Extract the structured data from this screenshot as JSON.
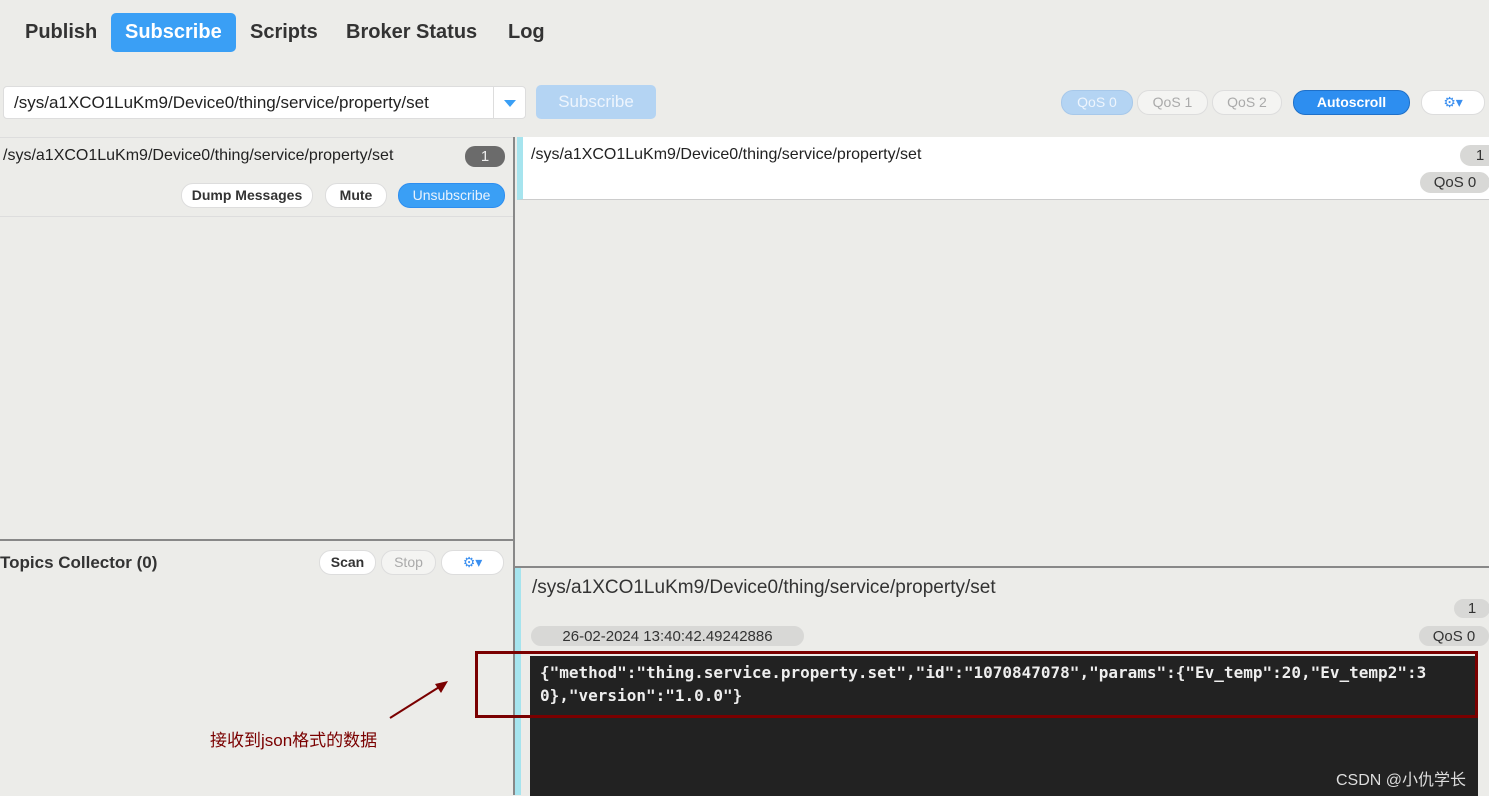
{
  "tabs": [
    {
      "label": "Publish"
    },
    {
      "label": "Subscribe",
      "active": true
    },
    {
      "label": "Scripts"
    },
    {
      "label": "Broker Status"
    },
    {
      "label": "Log"
    }
  ],
  "subscribe_bar": {
    "topic_value": "/sys/a1XCO1LuKm9/Device0/thing/service/property/set",
    "subscribe_label": "Subscribe",
    "qos": [
      "QoS 0",
      "QoS 1",
      "QoS 2"
    ],
    "autoscroll_label": "Autoscroll"
  },
  "subscription": {
    "topic": "/sys/a1XCO1LuKm9/Device0/thing/service/property/set",
    "count": "1",
    "dump_label": "Dump Messages",
    "mute_label": "Mute",
    "unsubscribe_label": "Unsubscribe"
  },
  "topics_collector": {
    "title": "Topics Collector (0)",
    "scan_label": "Scan",
    "stop_label": "Stop"
  },
  "message_list": [
    {
      "topic": "/sys/a1XCO1LuKm9/Device0/thing/service/property/set",
      "count": "1",
      "qos": "QoS 0"
    }
  ],
  "message_detail": {
    "topic": "/sys/a1XCO1LuKm9/Device0/thing/service/property/set",
    "count": "1",
    "timestamp": "26-02-2024  13:40:42.49242886",
    "qos": "QoS 0",
    "payload": "{\"method\":\"thing.service.property.set\",\"id\":\"1070847078\",\"params\":{\"Ev_temp\":20,\"Ev_temp2\":30},\"version\":\"1.0.0\"}"
  },
  "annotation": {
    "text": "接收到json格式的数据",
    "color": "#7a0000"
  },
  "watermark": "CSDN @小仇学长",
  "colors": {
    "accent": "#3a9ff5",
    "payload_bg": "#222222",
    "stripe": "#a6e4ee"
  }
}
